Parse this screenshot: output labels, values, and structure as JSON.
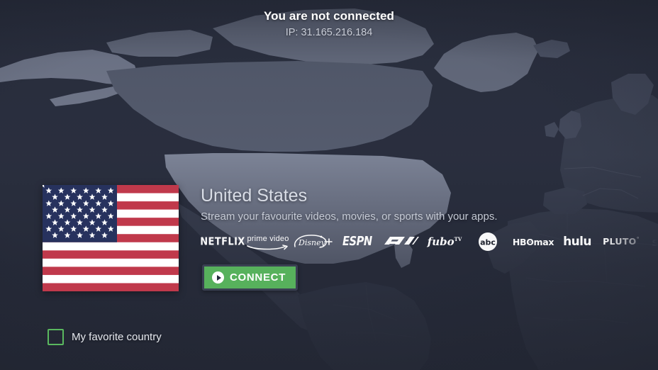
{
  "header": {
    "status_title": "You are not connected",
    "ip_label": "IP: 31.165.216.184"
  },
  "country_card": {
    "flag_icon": "us-flag-icon",
    "name": "United States",
    "tagline": "Stream your favourite videos, movies, or sports with your apps.",
    "services": [
      {
        "id": "netflix",
        "label": "NETFLIX"
      },
      {
        "id": "prime-video",
        "label": "prime video"
      },
      {
        "id": "disney-plus",
        "label": "Disney+"
      },
      {
        "id": "espn",
        "label": "ESPN"
      },
      {
        "id": "f1",
        "label": "F1"
      },
      {
        "id": "fubo-tv",
        "label": "fubo",
        "sup": "TV"
      },
      {
        "id": "abc",
        "label": "abc"
      },
      {
        "id": "hbo-max",
        "label": "HBʘmax"
      },
      {
        "id": "hulu",
        "label": "hulu"
      },
      {
        "id": "pluto-tv",
        "label": "PLUTO",
        "sup": "°"
      },
      {
        "id": "sling-tv",
        "label": "sli"
      }
    ]
  },
  "connect_button": {
    "label": "CONNECT",
    "icon": "play-icon",
    "color": "#57b15c",
    "focus_border": "#3a4052"
  },
  "favorite": {
    "label": "My favorite country",
    "checked": false,
    "accent": "#5ab85f"
  },
  "theme": {
    "background": "#2b3040",
    "land": "#3b4152",
    "land_light": "#7b8296",
    "highlight_country": "#868da1",
    "text_primary": "#ffffff",
    "text_secondary": "#c9cdd8"
  }
}
